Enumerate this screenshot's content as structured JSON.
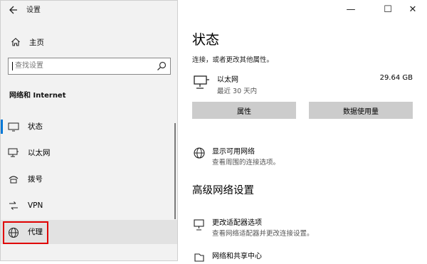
{
  "sidebar": {
    "app_title": "设置",
    "home_label": "主页",
    "search_placeholder": "查找设置",
    "section_title": "网络和 Internet",
    "items": [
      {
        "label": "状态",
        "icon": "status-icon"
      },
      {
        "label": "以太网",
        "icon": "ethernet-icon"
      },
      {
        "label": "拨号",
        "icon": "dialup-icon"
      },
      {
        "label": "VPN",
        "icon": "vpn-icon"
      },
      {
        "label": "代理",
        "icon": "globe-icon"
      }
    ]
  },
  "window_controls": {
    "minimize": "—",
    "maximize": "☐",
    "close": "✕"
  },
  "main": {
    "title": "状态",
    "description": "连接，或者更改其他属性。",
    "network": {
      "name": "以太网",
      "last_used": "最近 30 天内",
      "data_usage": "29.64 GB"
    },
    "buttons": {
      "properties": "属性",
      "data_usage": "数据使用量"
    },
    "show_networks": {
      "title": "显示可用网络",
      "subtitle": "查看周围的连接选项。"
    },
    "advanced_title": "高级网络设置",
    "adapter_options": {
      "title": "更改适配器选项",
      "subtitle": "查看网络适配器并更改连接设置。"
    },
    "sharing_center": {
      "title": "网络和共享中心"
    }
  },
  "colors": {
    "accent": "#0078d7",
    "highlight_box": "#e00000",
    "sidebar_bg": "#f2f2f2"
  }
}
